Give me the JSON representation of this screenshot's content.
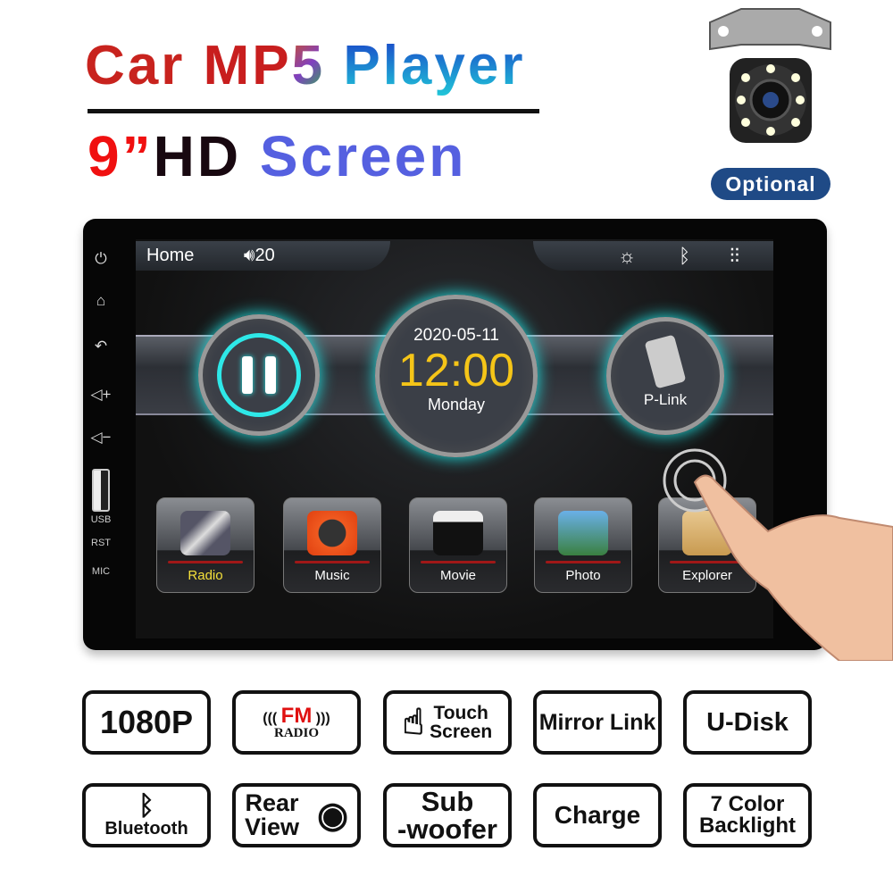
{
  "title": {
    "line1_a": "Car",
    "line1_b": "MP",
    "line1_c": "5",
    "line1_d": "Player",
    "line2_size": "9”",
    "line2_hd": "HD",
    "line2_screen": "Screen"
  },
  "camera": {
    "badge": "Optional"
  },
  "device": {
    "side_labels": {
      "usb": "USB",
      "rst": "RST",
      "mic": "MIC"
    },
    "status_bar": {
      "home": "Home",
      "volume": "20"
    },
    "clock": {
      "date": "2020-05-11",
      "time": "12:00",
      "day": "Monday"
    },
    "plink": "P-Link",
    "apps": [
      {
        "label": "Radio"
      },
      {
        "label": "Music"
      },
      {
        "label": "Movie"
      },
      {
        "label": "Photo"
      },
      {
        "label": "Explorer"
      }
    ]
  },
  "features": [
    {
      "label": "1080P"
    },
    {
      "fm": "FM",
      "radio": "RADIO"
    },
    {
      "label1": "Touch",
      "label2": "Screen"
    },
    {
      "label": "Mirror Link"
    },
    {
      "label": "U-Disk"
    },
    {
      "label": "Bluetooth"
    },
    {
      "label1": "Rear",
      "label2": "View"
    },
    {
      "label1": "Sub",
      "label2": "-woofer"
    },
    {
      "label": "Charge"
    },
    {
      "label1": "7 Color",
      "label2": "Backlight"
    }
  ],
  "colors": {
    "accent_cyan": "#2ee8e8",
    "clock_yellow": "#f5c518",
    "badge_blue": "#1f4a86"
  }
}
